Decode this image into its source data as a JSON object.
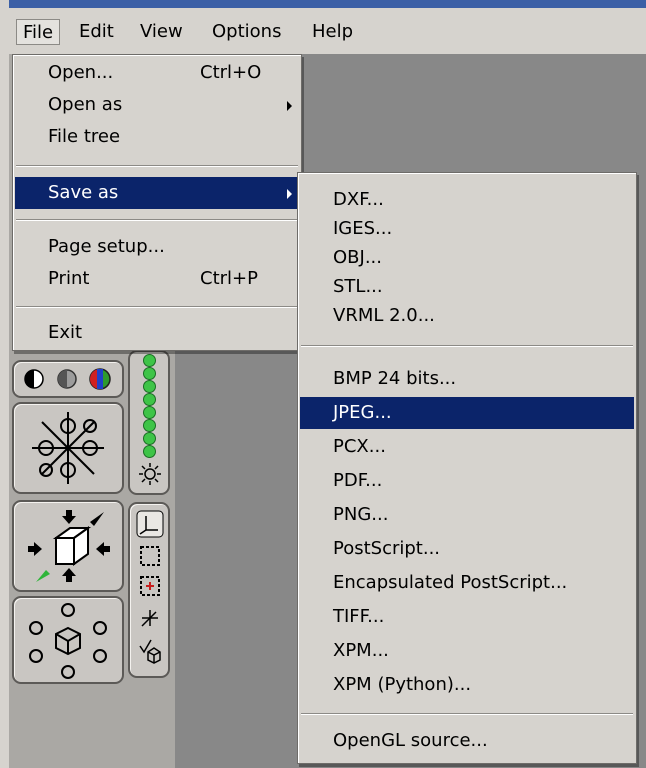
{
  "menubar": {
    "items": [
      {
        "label": "File"
      },
      {
        "label": "Edit"
      },
      {
        "label": "View"
      },
      {
        "label": "Options"
      },
      {
        "label": "Help"
      }
    ]
  },
  "file_menu": {
    "open": {
      "label": "Open...",
      "shortcut": "Ctrl+O"
    },
    "open_as": {
      "label": "Open as"
    },
    "file_tree": {
      "label": "File tree"
    },
    "save_as": {
      "label": "Save as"
    },
    "page_setup": {
      "label": "Page setup..."
    },
    "print": {
      "label": "Print",
      "shortcut": "Ctrl+P"
    },
    "exit": {
      "label": "Exit"
    }
  },
  "save_as_menu": {
    "items": [
      "DXF...",
      "IGES...",
      "OBJ...",
      "STL...",
      "VRML 2.0...",
      "BMP 24 bits...",
      "JPEG...",
      "PCX...",
      "PDF...",
      "PNG...",
      "PostScript...",
      "Encapsulated PostScript...",
      "TIFF...",
      "XPM...",
      "XPM (Python)...",
      "OpenGL source..."
    ],
    "highlighted": "JPEG..."
  },
  "colors": {
    "highlight": "#0b246a",
    "menu_bg": "#d6d3ce",
    "canvas": "#888888",
    "dots": "#3ec447"
  },
  "icons": [
    "render-mode-icons",
    "rotate-sphere-icon",
    "light-icon",
    "view-cube-icon",
    "view-fit-icon",
    "select-box-icon",
    "zoom-box-icon",
    "pick-icon",
    "view-sphere-icon"
  ]
}
